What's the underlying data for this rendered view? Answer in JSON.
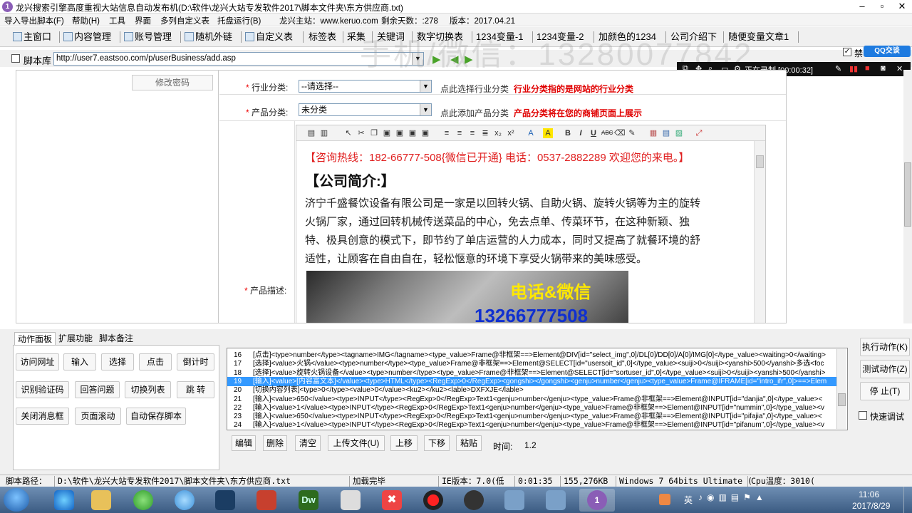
{
  "title_bar": {
    "title": "龙兴搜索引擎高度重视大站信息自动发布机(D:\\软件\\龙兴大站专发软件2017\\脚本文件夹\\东方供应商.txt)"
  },
  "menu": {
    "items": [
      "导入导出脚本(F)",
      "帮助(H)",
      "工具",
      "界面",
      "多列自定义表",
      "托盘运行(B)",
      "龙兴主站：www.keruo.com",
      "剩余天数：:278",
      "版本：2017.04.21"
    ]
  },
  "toolbar": {
    "items": [
      "主窗口",
      "内容管理",
      "账号管理",
      "随机外链",
      "自定义表",
      "标签表",
      "采集",
      "关键词",
      "数字切换表",
      "1234变量-1",
      "1234变量-2",
      "加颜色的1234",
      "公司介绍下",
      "随便变量文章1"
    ]
  },
  "address": {
    "checkbox_label": "脚本库",
    "url": "http://user7.eastsoo.com/p/userBusiness/add.asp",
    "right_checkbox_label": "禁",
    "qq_badge": "QQ交谈"
  },
  "watermark": "手机/微信：13280077842",
  "recording": {
    "status": "正在录制 [00:00:32]"
  },
  "webpage": {
    "left_button": "修改密码",
    "industry": {
      "label": "行业分类:",
      "selected": "--请选择--",
      "hint": "点此选择行业分类",
      "note": "行业分类指的是网站的行业分类"
    },
    "product_category": {
      "label": "产品分类:",
      "selected": "未分类",
      "hint": "点此添加产品分类",
      "note": "产品分类将在您的商铺页面上展示"
    },
    "description_label": "产品描述:",
    "editor": {
      "hotline": "【咨询热线：182-66777-508{微信已开通} 电话：0537-2882289 欢迎您的来电。】",
      "heading": "【公司简介:】",
      "lines": [
        "济宁千盛餐饮设备有限公司是一家是以回转火锅、自助火锅、旋转火锅等为主的旋转",
        "火锅厂家，通过回转机械传送菜品的中心，免去点单、传菜环节，在这种新颖、独",
        "特、极具创意的模式下，即节约了单店运营的人力成本，同时又提高了就餐环境的舒",
        "适性，让顾客在自由自在，轻松惬意的环境下享受火锅带来的美味感受。"
      ],
      "image_caption": "电话&微信",
      "image_phone": "13266777508"
    }
  },
  "panel_tabs": [
    "动作面板",
    "扩展功能",
    "脚本备注"
  ],
  "action_buttons": [
    "访问网址",
    "输入",
    "选择",
    "点击",
    "倒计时",
    "识别验证码",
    "回答问题",
    "切换列表",
    "跳 转",
    "关闭消息框",
    "页面滚动",
    "自动保存脚本"
  ],
  "script_rows": [
    {
      "no": "16",
      "text": "[点击]<type>number</type><tagname>IMG</tagname><type_value>Frame@非框架==>Element@DIV[id=\"select_img\",0]/DL[0]/DD[0]/A[0]/IMG[0]</type_value><waiting>0</waiting>"
    },
    {
      "no": "17",
      "text": "[选择]<value>火锅</value><type>number</type><type_value>Frame@非框架==>Element@SELECT[id=\"usersoit_id\",0]</type_value><suiji>0</suiji><yanshi>500</yanshi>多选<foc"
    },
    {
      "no": "18",
      "text": "[选择]<value>旋转火锅设备</value><type>number</type><type_value>Frame@非框架==>Element@SELECT[id=\"sortuser_id\",0]</type_value><suiji>0</suiji><yanshi>500</yanshi>"
    },
    {
      "no": "19",
      "text": "[输入]<value>[内容富文本]</value><type>HTML</type><RegExp>0</RegExp><gongshi></gongshi><genju>number</genju><type_value>Frame@IFRAME[id=\"intro_ifr\",0]>==>Elem"
    },
    {
      "no": "20",
      "text": "[切换内容列表]<type>0</type><value>0</value><ku2></ku2><lable>DXFXJE</lable>"
    },
    {
      "no": "21",
      "text": "[输入]<value>650</value><type>INPUT</type><RegExp>0</RegExp>Text1<genju>number</genju><type_value>Frame@非框架==>Element@INPUT[id=\"danjia\",0]</type_value><"
    },
    {
      "no": "22",
      "text": "[输入]<value>1</value><type>INPUT</type><RegExp>0</RegExp>Text1<genju>number</genju><type_value>Frame@非框架==>Element@INPUT[id=\"nummin\",0]</type_value><v"
    },
    {
      "no": "23",
      "text": "[输入]<value>650</value><type>INPUT</type><RegExp>0</RegExp>Text1<genju>number</genju><type_value>Frame@非框架==>Element@INPUT[id=\"pifajia\",0]</type_value><"
    },
    {
      "no": "24",
      "text": "[输入]<value>1</value><type>INPUT</type><RegExp>0</RegExp>Text1<genju>number</genju><type_value>Frame@非框架==>Element@INPUT[id=\"pifanum\",0]</type_value><v"
    }
  ],
  "script_buttons": [
    "编辑",
    "删除",
    "清空",
    "上传文件(U)",
    "上移",
    "下移",
    "粘贴"
  ],
  "time": {
    "label": "时间:",
    "value": "1.2"
  },
  "run_buttons": [
    "执行动作(K)",
    "测试动作(Z)",
    "停 止(T)"
  ],
  "fast_debug_label": "快速调试",
  "status_bar": {
    "path_label": "脚本路径：",
    "path": "D:\\软件\\龙兴大站专发软件2017\\脚本文件夹\\东方供应商.txt",
    "load": "加载完毕",
    "ie": "IE版本：7.0(低",
    "elapsed": "0:01:35",
    "memory": "155,276KB",
    "os": "Windows 7 64bits Ultimate (",
    "cpu": "Cpu温度：3010("
  },
  "taskbar": {
    "ime": "英",
    "time": "11:06",
    "date": "2017/8/29"
  }
}
